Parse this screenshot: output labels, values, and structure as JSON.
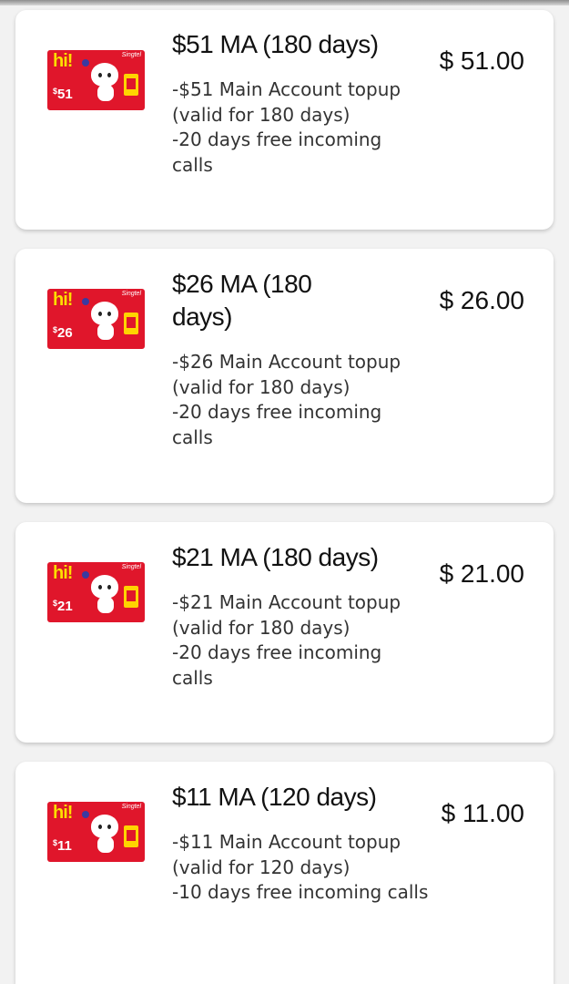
{
  "plans": [
    {
      "title": "$51 MA (180 days)",
      "description": "-$51 Main Account topup (valid for 180 days)\n-20 days free incoming calls",
      "price": "$ 51.00",
      "card_amount": "51",
      "card_brand": "hi!",
      "card_operator": "Singtel"
    },
    {
      "title": "$26 MA (180 days)",
      "description": "-$26 Main Account topup (valid for 180 days)\n-20 days free incoming calls",
      "price": "$ 26.00",
      "card_amount": "26",
      "card_brand": "hi!",
      "card_operator": "Singtel"
    },
    {
      "title": "$21 MA (180 days)",
      "description": "-$21 Main Account topup (valid for 180 days)\n-20 days free incoming calls",
      "price": "$ 21.00",
      "card_amount": "21",
      "card_brand": "hi!",
      "card_operator": "Singtel"
    },
    {
      "title": "$11 MA (120 days)",
      "description": "-$11 Main Account topup (valid for 120 days)\n-10 days free incoming calls",
      "price": "$ 11.00",
      "card_amount": "11",
      "card_brand": "hi!",
      "card_operator": "Singtel"
    }
  ],
  "colors": {
    "card_red": "#e0162b",
    "brand_yellow": "#ffde00",
    "background": "#f2f2f2"
  }
}
